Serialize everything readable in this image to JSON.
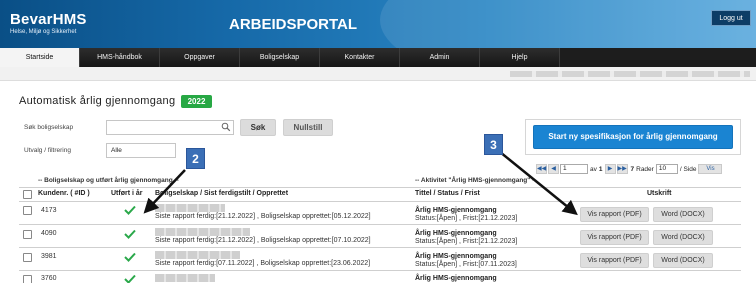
{
  "header": {
    "logo_title": "BevarHMS",
    "logo_subtitle": "Helse, Miljø og Sikkerhet",
    "portal_title": "ARBEIDSPORTAL",
    "logout_label": "Logg ut"
  },
  "nav": {
    "items": [
      "Startside",
      "HMS-håndbok",
      "Oppgaver",
      "Boligselskap",
      "Kontakter",
      "Admin",
      "Hjelp"
    ],
    "active": "Startside"
  },
  "page": {
    "title": "Automatisk årlig gjennomgang",
    "year_badge": "2022"
  },
  "filters": {
    "search_label": "Søk boligselskap",
    "search_value": "",
    "search_button": "Søk",
    "reset_button": "Nullstill",
    "select_label": "Utvalg / filtrering",
    "select_value": "Alle"
  },
  "actions": {
    "start_button": "Start ny spesifikasjon for årlig gjennomgang"
  },
  "pager": {
    "first": "◀◀",
    "prev": "◀",
    "page_value": "1",
    "of_label": "av",
    "total_pages": "1",
    "next": "▶",
    "last": "▶▶",
    "page_count_display": "7",
    "rows_label": "Rader",
    "rows_value": "10",
    "per_page_label": "/ Side",
    "show_button": "Vis"
  },
  "table": {
    "group_left": "-- Boligselskap og utført årlig gjennomgang --",
    "group_right": "-- Aktivitet \"Årlig HMS-gjennomgang\" --",
    "columns": {
      "id": "Kundenr. ( #ID )",
      "done": "Utført i år",
      "company": "Boligselskap / Sist ferdigstilt / Opprettet",
      "task": "Tittel / Status / Frist",
      "print": "Utskrift"
    },
    "rows": [
      {
        "id": "4173",
        "done": true,
        "company_details": "Siste rapport ferdig:[21.12.2022] , Boligselskap opprettet:[05.12.2022]",
        "task_title": "Årlig HMS-gjennomgang",
        "task_status": "Status:[Åpen] , Frist:[21.12.2023]",
        "pdf_button": "Vis rapport (PDF)",
        "docx_button": "Word (DOCX)"
      },
      {
        "id": "4090",
        "done": true,
        "company_details": "Siste rapport ferdig:[21.12.2022] , Boligselskap opprettet:[07.10.2022]",
        "task_title": "Årlig HMS-gjennomgang",
        "task_status": "Status:[Åpen] , Frist:[21.12.2023]",
        "pdf_button": "Vis rapport (PDF)",
        "docx_button": "Word (DOCX)"
      },
      {
        "id": "3981",
        "done": true,
        "company_details": "Siste rapport ferdig:[07.11.2022] , Boligselskap opprettet:[23.06.2022]",
        "task_title": "Årlig HMS-gjennomgang",
        "task_status": "Status:[Åpen] , Frist:[07.11.2023]",
        "pdf_button": "Vis rapport (PDF)",
        "docx_button": "Word (DOCX)"
      },
      {
        "id": "3760",
        "done": true,
        "company_details": "",
        "task_title": "Årlig HMS-gjennomgang",
        "task_status": "",
        "pdf_button": "",
        "docx_button": ""
      }
    ]
  },
  "callouts": [
    "2",
    "3"
  ],
  "colors": {
    "header_blue": "#1669a8",
    "badge_green": "#27a844",
    "primary_button": "#1a84d2",
    "callout_blue": "#3b6fb6",
    "check_green": "#2aa84a"
  }
}
